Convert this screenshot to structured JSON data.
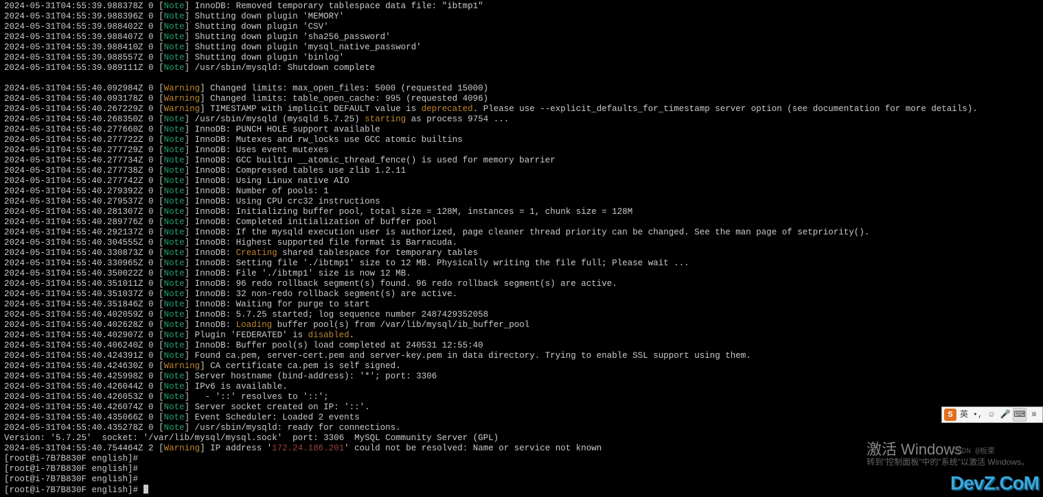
{
  "terminal": {
    "lines": [
      {
        "ts": "2024-05-31T04:55:39.988378Z 0",
        "lvl": "Note",
        "txt": " InnoDB: Removed temporary tablespace data file: \"ibtmp1\""
      },
      {
        "ts": "2024-05-31T04:55:39.988396Z 0",
        "lvl": "Note",
        "txt": " Shutting down plugin 'MEMORY'"
      },
      {
        "ts": "2024-05-31T04:55:39.988402Z 0",
        "lvl": "Note",
        "txt": " Shutting down plugin 'CSV'"
      },
      {
        "ts": "2024-05-31T04:55:39.988407Z 0",
        "lvl": "Note",
        "txt": " Shutting down plugin 'sha256_password'"
      },
      {
        "ts": "2024-05-31T04:55:39.988410Z 0",
        "lvl": "Note",
        "txt": " Shutting down plugin 'mysql_native_password'"
      },
      {
        "ts": "2024-05-31T04:55:39.988557Z 0",
        "lvl": "Note",
        "txt": " Shutting down plugin 'binlog'"
      },
      {
        "ts": "2024-05-31T04:55:39.989111Z 0",
        "lvl": "Note",
        "txt": " /usr/sbin/mysqld: Shutdown complete"
      },
      {
        "blank": true
      },
      {
        "ts": "2024-05-31T04:55:40.092984Z 0",
        "lvl": "Warning",
        "txt": " Changed limits: max_open_files: 5000 (requested 15000)"
      },
      {
        "ts": "2024-05-31T04:55:40.093178Z 0",
        "lvl": "Warning",
        "txt": " Changed limits: table_open_cache: 995 (requested 4096)"
      },
      {
        "ts": "2024-05-31T04:55:40.267229Z 0",
        "lvl": "Warning",
        "txt": " TIMESTAMP with implicit DEFAULT value is ",
        "hl": "deprecated",
        "txt2": ". Please use --explicit_defaults_for_timestamp server option (see documentation for more details)."
      },
      {
        "ts": "2024-05-31T04:55:40.268350Z 0",
        "lvl": "Note",
        "txt": " /usr/sbin/mysqld (mysqld 5.7.25) ",
        "hl": "starting",
        "txt2": " as process 9754 ..."
      },
      {
        "ts": "2024-05-31T04:55:40.277660Z 0",
        "lvl": "Note",
        "txt": " InnoDB: PUNCH HOLE support available"
      },
      {
        "ts": "2024-05-31T04:55:40.277722Z 0",
        "lvl": "Note",
        "txt": " InnoDB: Mutexes and rw_locks use GCC atomic builtins"
      },
      {
        "ts": "2024-05-31T04:55:40.277729Z 0",
        "lvl": "Note",
        "txt": " InnoDB: Uses event mutexes"
      },
      {
        "ts": "2024-05-31T04:55:40.277734Z 0",
        "lvl": "Note",
        "txt": " InnoDB: GCC builtin __atomic_thread_fence() is used for memory barrier"
      },
      {
        "ts": "2024-05-31T04:55:40.277738Z 0",
        "lvl": "Note",
        "txt": " InnoDB: Compressed tables use zlib 1.2.11"
      },
      {
        "ts": "2024-05-31T04:55:40.277742Z 0",
        "lvl": "Note",
        "txt": " InnoDB: Using Linux native AIO"
      },
      {
        "ts": "2024-05-31T04:55:40.279392Z 0",
        "lvl": "Note",
        "txt": " InnoDB: Number of pools: 1"
      },
      {
        "ts": "2024-05-31T04:55:40.279537Z 0",
        "lvl": "Note",
        "txt": " InnoDB: Using CPU crc32 instructions"
      },
      {
        "ts": "2024-05-31T04:55:40.281307Z 0",
        "lvl": "Note",
        "txt": " InnoDB: Initializing buffer pool, total size = 128M, instances = 1, chunk size = 128M"
      },
      {
        "ts": "2024-05-31T04:55:40.289776Z 0",
        "lvl": "Note",
        "txt": " InnoDB: Completed initialization of buffer pool"
      },
      {
        "ts": "2024-05-31T04:55:40.292137Z 0",
        "lvl": "Note",
        "txt": " InnoDB: If the mysqld execution user is authorized, page cleaner thread priority can be changed. See the man page of setpriority()."
      },
      {
        "ts": "2024-05-31T04:55:40.304555Z 0",
        "lvl": "Note",
        "txt": " InnoDB: Highest supported file format is Barracuda."
      },
      {
        "ts": "2024-05-31T04:55:40.330873Z 0",
        "lvl": "Note",
        "txt": " InnoDB: ",
        "hl": "Creating",
        "txt2": " shared tablespace for temporary tables"
      },
      {
        "ts": "2024-05-31T04:55:40.330965Z 0",
        "lvl": "Note",
        "txt": " InnoDB: Setting file './ibtmp1' size to 12 MB. Physically writing the file full; Please wait ..."
      },
      {
        "ts": "2024-05-31T04:55:40.350022Z 0",
        "lvl": "Note",
        "txt": " InnoDB: File './ibtmp1' size is now 12 MB."
      },
      {
        "ts": "2024-05-31T04:55:40.351011Z 0",
        "lvl": "Note",
        "txt": " InnoDB: 96 redo rollback segment(s) found. 96 redo rollback segment(s) are active."
      },
      {
        "ts": "2024-05-31T04:55:40.351037Z 0",
        "lvl": "Note",
        "txt": " InnoDB: 32 non-redo rollback segment(s) are active."
      },
      {
        "ts": "2024-05-31T04:55:40.351846Z 0",
        "lvl": "Note",
        "txt": " InnoDB: Waiting for purge to start"
      },
      {
        "ts": "2024-05-31T04:55:40.402059Z 0",
        "lvl": "Note",
        "txt": " InnoDB: 5.7.25 started; log sequence number 2487429352058"
      },
      {
        "ts": "2024-05-31T04:55:40.402628Z 0",
        "lvl": "Note",
        "txt": " InnoDB: ",
        "hl": "Loading",
        "txt2": " buffer pool(s) from /var/lib/mysql/ib_buffer_pool"
      },
      {
        "ts": "2024-05-31T04:55:40.402907Z 0",
        "lvl": "Note",
        "txt": " Plugin 'FEDERATED' is ",
        "hl": "disabled",
        "txt2": "."
      },
      {
        "ts": "2024-05-31T04:55:40.406240Z 0",
        "lvl": "Note",
        "txt": " InnoDB: Buffer pool(s) load completed at 240531 12:55:40"
      },
      {
        "ts": "2024-05-31T04:55:40.424391Z 0",
        "lvl": "Note",
        "txt": " Found ca.pem, server-cert.pem and server-key.pem in data directory. Trying to enable SSL support using them."
      },
      {
        "ts": "2024-05-31T04:55:40.424630Z 0",
        "lvl": "Warning",
        "txt": " CA certificate ca.pem is self signed."
      },
      {
        "ts": "2024-05-31T04:55:40.425998Z 0",
        "lvl": "Note",
        "txt": " Server hostname (bind-address): '*'; port: 3306"
      },
      {
        "ts": "2024-05-31T04:55:40.426044Z 0",
        "lvl": "Note",
        "txt": " IPv6 is available."
      },
      {
        "ts": "2024-05-31T04:55:40.426053Z 0",
        "lvl": "Note",
        "txt": "   - '::' resolves to '::';"
      },
      {
        "ts": "2024-05-31T04:55:40.426074Z 0",
        "lvl": "Note",
        "txt": " Server socket created on IP: '::'."
      },
      {
        "ts": "2024-05-31T04:55:40.435066Z 0",
        "lvl": "Note",
        "txt": " Event Scheduler: Loaded 2 events"
      },
      {
        "ts": "2024-05-31T04:55:40.435278Z 0",
        "lvl": "Note",
        "txt": " /usr/sbin/mysqld: ready for connections."
      },
      {
        "plain": "Version: '5.7.25'  socket: '/var/lib/mysql/mysql.sock'  port: 3306  MySQL Community Server (GPL)"
      },
      {
        "ts": "2024-05-31T04:55:40.754464Z 2",
        "lvl": "Warning",
        "txt": " IP address '",
        "ip": "172.24.186.201",
        "txt2": "' could not be resolved: Name or service not known"
      }
    ],
    "prompts": [
      "[root@i-7B7B830F english]#",
      "[root@i-7B7B830F english]#",
      "[root@i-7B7B830F english]#",
      "[root@i-7B7B830F english]# "
    ]
  },
  "watermark": {
    "title": "激活 Windows",
    "subtitle": "转到\"控制面板\"中的\"系统\"以激活 Windows。",
    "csdn": "CSDN @板栗"
  },
  "devz": {
    "text": "DevZ.CoM"
  },
  "ime": {
    "brand": "S",
    "mode": "英",
    "items": [
      "punct",
      "emoji",
      "mic",
      "keyboard",
      "gear"
    ]
  }
}
